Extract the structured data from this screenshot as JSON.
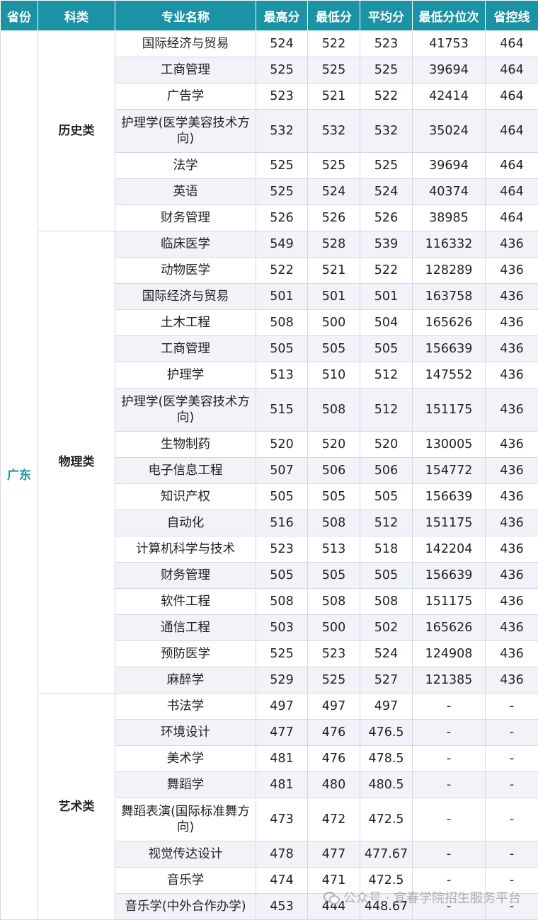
{
  "headers": [
    "省份",
    "科类",
    "专业名称",
    "最高分",
    "最低分",
    "平均分",
    "最低分位次",
    "省控线"
  ],
  "province": "广东",
  "groups": [
    {
      "category": "历史类",
      "rows": [
        [
          "国际经济与贸易",
          "524",
          "522",
          "523",
          "41753",
          "464"
        ],
        [
          "工商管理",
          "525",
          "525",
          "525",
          "39694",
          "464"
        ],
        [
          "广告学",
          "523",
          "521",
          "522",
          "42414",
          "464"
        ],
        [
          "护理学(医学美容技术方向)",
          "532",
          "532",
          "532",
          "35024",
          "464"
        ],
        [
          "法学",
          "525",
          "525",
          "525",
          "39694",
          "464"
        ],
        [
          "英语",
          "525",
          "524",
          "524",
          "40374",
          "464"
        ],
        [
          "财务管理",
          "526",
          "526",
          "526",
          "38985",
          "464"
        ]
      ]
    },
    {
      "category": "物理类",
      "rows": [
        [
          "临床医学",
          "549",
          "528",
          "539",
          "116332",
          "436"
        ],
        [
          "动物医学",
          "522",
          "521",
          "522",
          "128289",
          "436"
        ],
        [
          "国际经济与贸易",
          "501",
          "501",
          "501",
          "163758",
          "436"
        ],
        [
          "土木工程",
          "508",
          "500",
          "504",
          "165626",
          "436"
        ],
        [
          "工商管理",
          "505",
          "505",
          "505",
          "156639",
          "436"
        ],
        [
          "护理学",
          "513",
          "510",
          "512",
          "147552",
          "436"
        ],
        [
          "护理学(医学美容技术方向)",
          "515",
          "508",
          "512",
          "151175",
          "436"
        ],
        [
          "生物制药",
          "520",
          "520",
          "520",
          "130005",
          "436"
        ],
        [
          "电子信息工程",
          "507",
          "506",
          "506",
          "154772",
          "436"
        ],
        [
          "知识产权",
          "505",
          "505",
          "505",
          "156639",
          "436"
        ],
        [
          "自动化",
          "516",
          "508",
          "512",
          "151175",
          "436"
        ],
        [
          "计算机科学与技术",
          "523",
          "513",
          "518",
          "142204",
          "436"
        ],
        [
          "财务管理",
          "505",
          "505",
          "505",
          "156639",
          "436"
        ],
        [
          "软件工程",
          "508",
          "508",
          "508",
          "151175",
          "436"
        ],
        [
          "通信工程",
          "503",
          "500",
          "502",
          "165626",
          "436"
        ],
        [
          "预防医学",
          "525",
          "523",
          "524",
          "124908",
          "436"
        ],
        [
          "麻醉学",
          "529",
          "525",
          "527",
          "121385",
          "436"
        ]
      ]
    },
    {
      "category": "艺术类",
      "rows": [
        [
          "书法学",
          "497",
          "497",
          "497",
          "-",
          "-"
        ],
        [
          "环境设计",
          "477",
          "476",
          "476.5",
          "-",
          "-"
        ],
        [
          "美术学",
          "481",
          "476",
          "478.5",
          "-",
          "-"
        ],
        [
          "舞蹈学",
          "481",
          "480",
          "480.5",
          "-",
          "-"
        ],
        [
          "舞蹈表演(国际标准舞方向)",
          "473",
          "472",
          "472.5",
          "-",
          "-"
        ],
        [
          "视觉传达设计",
          "478",
          "477",
          "477.67",
          "-",
          "-"
        ],
        [
          "音乐学",
          "474",
          "471",
          "472.5",
          "-",
          "-"
        ],
        [
          "音乐学(中外合作办学)",
          "453",
          "444",
          "448.67",
          "-",
          "-"
        ]
      ]
    }
  ],
  "watermark": "公众号 · 宜春学院招生服务平台",
  "colors": {
    "header_bg": "#1b93a4",
    "province_text": "#1b93a4",
    "stripe": "#f2f3f8",
    "border": "#d4d7e6"
  }
}
